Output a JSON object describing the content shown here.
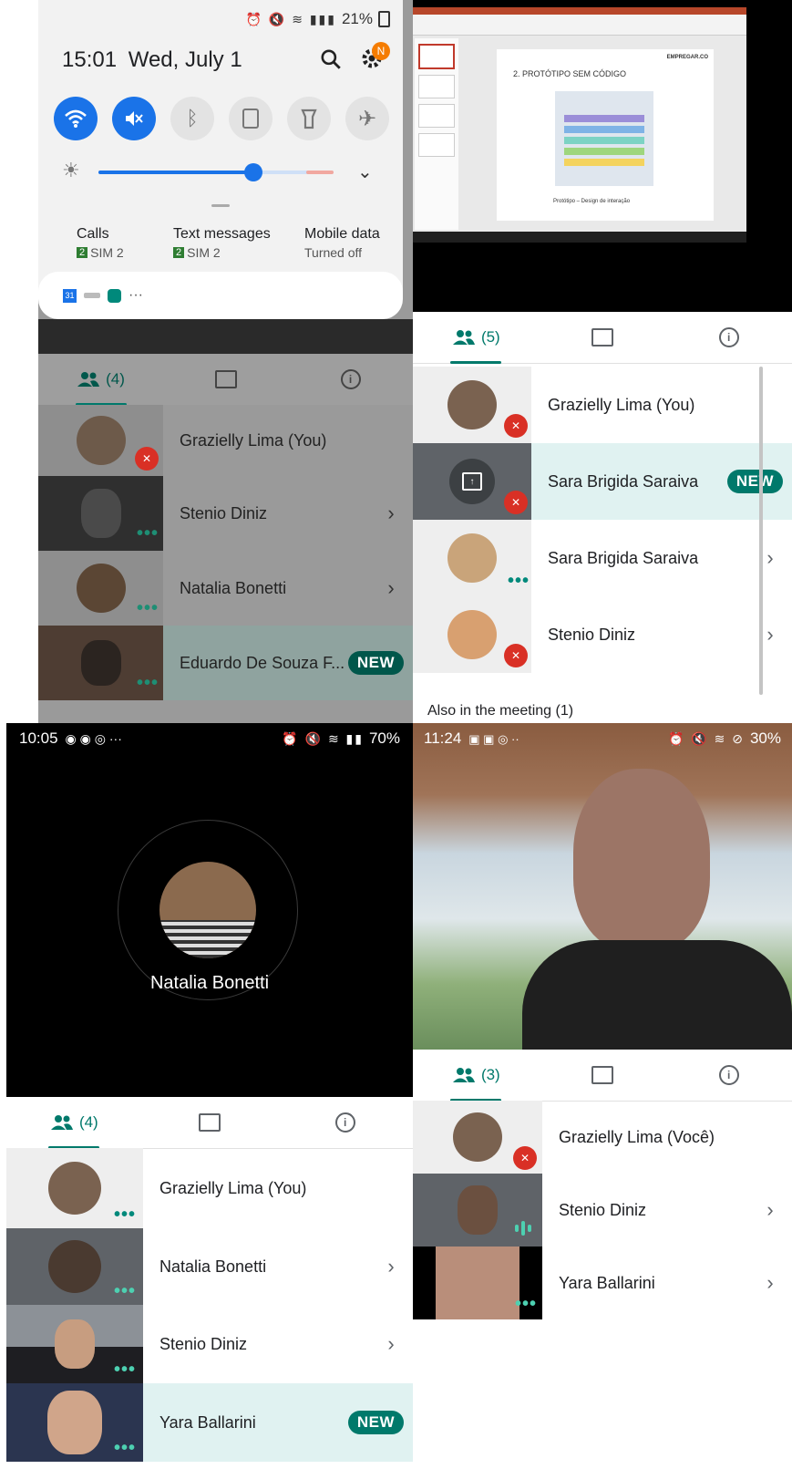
{
  "p1": {
    "status": {
      "battery": "21%"
    },
    "qs": {
      "time": "15:01",
      "date": "Wed, July 1",
      "notif_initial": "N"
    },
    "sims": [
      {
        "title": "Calls",
        "sub": "SIM 2",
        "sim": "2"
      },
      {
        "title": "Text messages",
        "sub": "SIM 2",
        "sim": "2"
      },
      {
        "title": "Mobile data",
        "sub": "Turned off"
      }
    ],
    "notif": {
      "more": "···",
      "cal_label": "31"
    },
    "tabs": {
      "people_count": "(4)"
    },
    "participants": [
      {
        "name": "Grazielly Lima (You)"
      },
      {
        "name": "Stenio Diniz"
      },
      {
        "name": "Natalia Bonetti"
      },
      {
        "name": "Eduardo De Souza F...",
        "badge": "NEW"
      }
    ]
  },
  "p2": {
    "slide": {
      "title": "2. PROTÓTIPO SEM CÓDIGO",
      "brand": "EMPREGAR.CO",
      "caption": "Protótipo – Design de interação"
    },
    "tabs": {
      "people_count": "(5)"
    },
    "participants": [
      {
        "name": "Grazielly Lima (You)"
      },
      {
        "name": "Sara Brigida Saraiva",
        "badge": "NEW"
      },
      {
        "name": "Sara Brigida Saraiva"
      },
      {
        "name": "Stenio Diniz"
      }
    ],
    "also": "Also in the meeting (1)"
  },
  "p3": {
    "status": {
      "time": "10:05",
      "battery": "70%"
    },
    "speaker": "Natalia Bonetti",
    "tabs": {
      "people_count": "(4)"
    },
    "participants": [
      {
        "name": "Grazielly Lima (You)"
      },
      {
        "name": "Natalia Bonetti"
      },
      {
        "name": "Stenio Diniz"
      },
      {
        "name": "Yara Ballarini",
        "badge": "NEW"
      }
    ]
  },
  "p4": {
    "status": {
      "time": "11:24",
      "battery": "30%"
    },
    "tabs": {
      "people_count": "(3)"
    },
    "participants": [
      {
        "name": "Grazielly Lima (Você)"
      },
      {
        "name": "Stenio Diniz"
      },
      {
        "name": "Yara Ballarini"
      }
    ]
  },
  "colors": {
    "accent": "#00796b",
    "qs_blue": "#1a73e8",
    "mic_off": "#d93025",
    "dots": "#4dd0b1",
    "highlight": "#e0f2f1"
  }
}
